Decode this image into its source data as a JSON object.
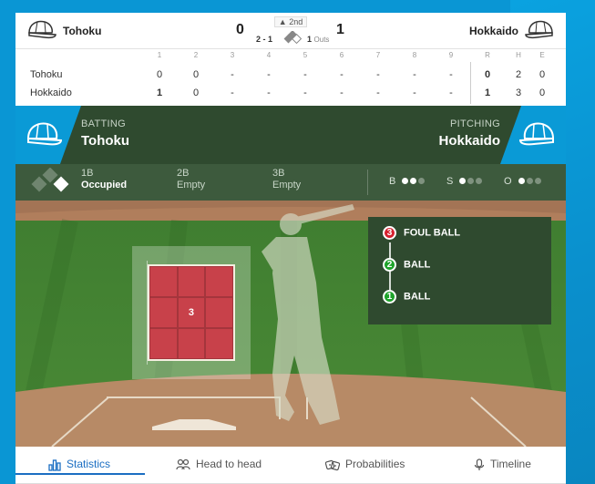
{
  "header": {
    "home_team": "Tohoku",
    "away_team": "Hokkaido",
    "home_score": "0",
    "away_score": "1",
    "inning": "▲ 2nd",
    "count": "2 - 1",
    "outs_value": "1",
    "outs_label": "Outs"
  },
  "linescore": {
    "innings": [
      "1",
      "2",
      "3",
      "4",
      "5",
      "6",
      "7",
      "8",
      "9"
    ],
    "totals_headers": [
      "R",
      "H",
      "E"
    ],
    "rows": [
      {
        "team": "Tohoku",
        "innings": [
          "0",
          "0",
          "-",
          "-",
          "-",
          "-",
          "-",
          "-",
          "-"
        ],
        "totals": [
          "0",
          "2",
          "0"
        ]
      },
      {
        "team": "Hokkaido",
        "innings": [
          "1",
          "0",
          "-",
          "-",
          "-",
          "-",
          "-",
          "-",
          "-"
        ],
        "totals": [
          "1",
          "3",
          "0"
        ]
      }
    ]
  },
  "matchup": {
    "batting_label": "BATTING",
    "batting_team": "Tohoku",
    "pitching_label": "PITCHING",
    "pitching_team": "Hokkaido"
  },
  "bases": {
    "first": {
      "label": "1B",
      "state": "Occupied"
    },
    "second": {
      "label": "2B",
      "state": "Empty"
    },
    "third": {
      "label": "3B",
      "state": "Empty"
    }
  },
  "count_dots": {
    "balls": {
      "label": "B",
      "on": 2,
      "total": 3
    },
    "strikes": {
      "label": "S",
      "on": 1,
      "total": 3
    },
    "outs": {
      "label": "O",
      "on": 1,
      "total": 3
    }
  },
  "strike_zone": {
    "pitch_number": "3"
  },
  "events": [
    {
      "number": "3",
      "label": "FOUL BALL",
      "color": "#d6212f"
    },
    {
      "number": "2",
      "label": "BALL",
      "color": "#1ea32a"
    },
    {
      "number": "1",
      "label": "BALL",
      "color": "#1ea32a"
    }
  ],
  "tabs": [
    {
      "label": "Statistics",
      "icon": "bar-chart-icon",
      "active": true
    },
    {
      "label": "Head to head",
      "icon": "people-icon",
      "active": false
    },
    {
      "label": "Probabilities",
      "icon": "dice-icon",
      "active": false
    },
    {
      "label": "Timeline",
      "icon": "microphone-icon",
      "active": false
    }
  ],
  "colors": {
    "accent_blue": "#0a9ad6",
    "dark_green": "#2f4a2f",
    "active_tab": "#1b6ec2"
  }
}
